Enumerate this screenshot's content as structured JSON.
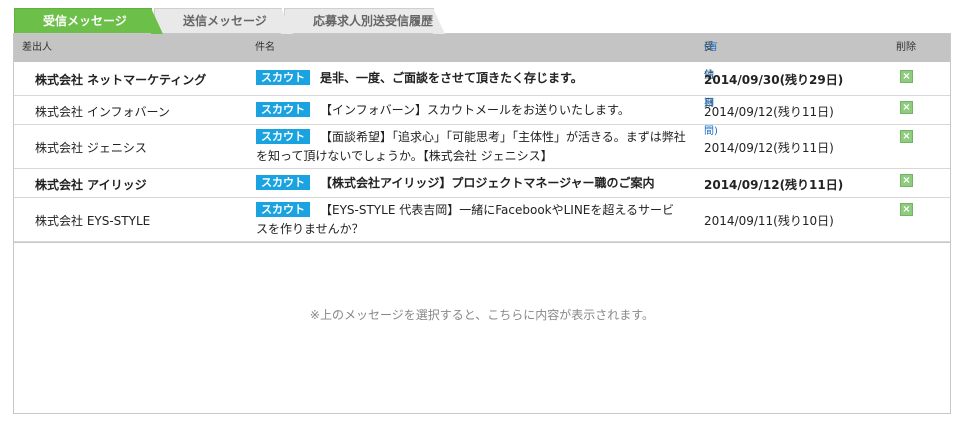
{
  "tabs": [
    {
      "label": "受信メッセージ",
      "active": true
    },
    {
      "label": "送信メッセージ",
      "active": false
    },
    {
      "label": "応募求人別送受信履歴",
      "active": false
    }
  ],
  "list_header": {
    "sender": "差出人",
    "subject": "件名",
    "date": "受信日",
    "date_validity": "(有効期間)",
    "delete": "削除"
  },
  "messages": [
    {
      "sender": "株式会社 ネットマーケティング",
      "badge": "スカウト",
      "subject": "是非、一度、ご面談をさせて頂きたく存じます。",
      "date": "2014/09/30(残り29日)",
      "unread": true,
      "delete_icon": "close-x-icon"
    },
    {
      "sender": "株式会社 インフォバーン",
      "badge": "スカウト",
      "subject": "【インフォバーン】スカウトメールをお送りいたします。",
      "date": "2014/09/12(残り11日)",
      "unread": false,
      "delete_icon": "close-x-icon"
    },
    {
      "sender": "株式会社 ジェニシス",
      "badge": "スカウト",
      "subject": "【面談希望】「追求心」「可能思考」「主体性」が活きる。まずは弊社を知って頂けないでしょうか。【株式会社 ジェニシス】",
      "date": "2014/09/12(残り11日)",
      "unread": false,
      "delete_icon": "close-x-icon"
    },
    {
      "sender": "株式会社 アイリッジ",
      "badge": "スカウト",
      "subject": "【株式会社アイリッジ】プロジェクトマネージャー職のご案内",
      "date": "2014/09/12(残り11日)",
      "unread": true,
      "delete_icon": "close-x-icon"
    },
    {
      "sender": "株式会社 EYS-STYLE",
      "badge": "スカウト",
      "subject": "【EYS-STYLE 代表吉岡】一緒にFacebookやLINEを超えるサービスを作りませんか？",
      "date": "2014/09/11(残り10日)",
      "unread": false,
      "delete_icon": "close-x-icon"
    }
  ],
  "preview": {
    "placeholder": "※上のメッセージを選択すると、こちらに内容が表示されます。"
  },
  "colors": {
    "active_tab": "#6cbf48",
    "badge": "#1aa3e0",
    "header_bg": "#c4c4c4",
    "delete_icon": "#8fcc7f",
    "link": "#1a6fc4"
  }
}
